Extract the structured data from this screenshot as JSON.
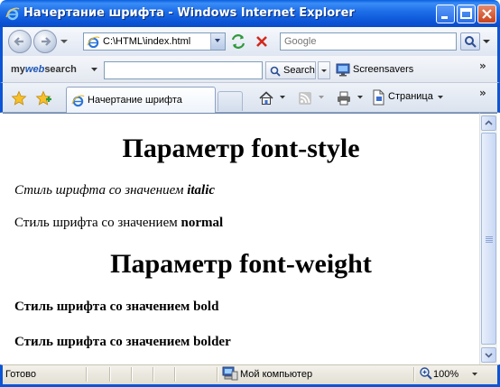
{
  "window": {
    "title": "Начертание шрифта - Windows Internet Explorer"
  },
  "address_bar": {
    "url": "C:\\HTML\\index.html",
    "search_placeholder": "Google"
  },
  "mywebsearch": {
    "brand_prefix": "my",
    "brand_web": "web",
    "brand_suffix": "search",
    "search_label": "Search",
    "screensavers_label": "Screensavers"
  },
  "tabs": [
    {
      "label": "Начертание шрифта"
    }
  ],
  "command_bar": {
    "page_label": "Страница"
  },
  "content": {
    "heading1": "Параметр font-style",
    "para1_text": "Стиль шрифта со значением ",
    "para1_value": "italic",
    "para2_text": "Стиль шрифта со значением ",
    "para2_value": "normal",
    "heading2": "Параметр font-weight",
    "para3": "Стиль шрифта со значением bold",
    "para4": "Стиль шрифта со значением bolder"
  },
  "status_bar": {
    "status": "Готово",
    "zone": "Мой компьютер",
    "zoom": "100%"
  }
}
